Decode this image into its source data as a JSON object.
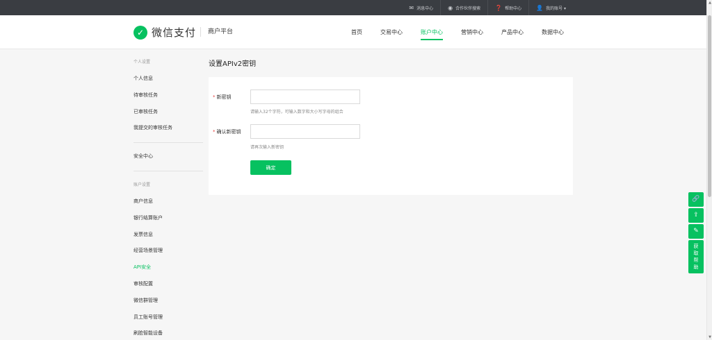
{
  "topbar": {
    "links": [
      {
        "icon": "mail-icon",
        "glyph": "✉",
        "label": "消息中心"
      },
      {
        "icon": "partner-search-icon",
        "glyph": "◉",
        "label": "合作伙伴搜索"
      },
      {
        "icon": "help-icon",
        "glyph": "❓",
        "label": "帮助中心"
      },
      {
        "icon": "user-icon",
        "glyph": "👤",
        "label": "我的账号 ▾"
      }
    ]
  },
  "header": {
    "logo_text": "微信支付",
    "platform": "商户平台",
    "nav": [
      "首页",
      "交易中心",
      "账户中心",
      "营销中心",
      "产品中心",
      "数据中心"
    ]
  },
  "sidebar": {
    "group1_title": "个人设置",
    "group1_items": [
      "个人信息",
      "待审核任务",
      "已审核任务",
      "我提交的审核任务"
    ],
    "security": "安全中心",
    "group2_title": "账户设置",
    "group2_items": [
      "商户信息",
      "银行结算账户",
      "发票信息",
      "经营场景管理",
      "API安全",
      "审核配置",
      "微信群管理",
      "员工账号管理",
      "刷脸智能设备"
    ]
  },
  "main": {
    "title": "设置APIv2密钥",
    "new_key": {
      "required": "*",
      "label": "新密钥",
      "hint": "请输入32个字符，可输入数字和大小写字母的组合",
      "value": ""
    },
    "confirm_key": {
      "required": "*",
      "label": "确认新密钥",
      "hint": "请再次输入新密钥",
      "value": ""
    },
    "confirm_button": "确定"
  },
  "float_tools": {
    "icons": [
      "link-icon",
      "upload-icon",
      "edit-icon"
    ],
    "help_chars": [
      "获",
      "取",
      "帮",
      "助"
    ]
  },
  "colors": {
    "accent": "#07c160",
    "topbar": "#3a3d42",
    "required": "#e64340"
  }
}
